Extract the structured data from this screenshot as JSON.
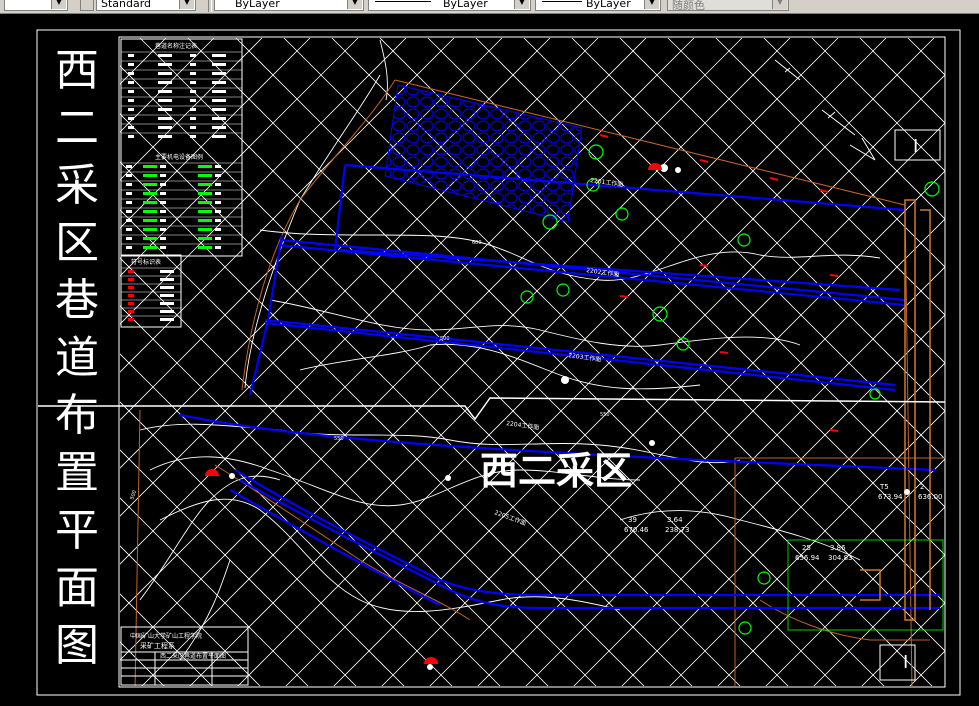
{
  "toolbar": {
    "text_style": "Standard",
    "layer": "ByLayer",
    "linetype": "ByLayer",
    "lineweight": "ByLayer",
    "plot_style": "随颜色"
  },
  "drawing": {
    "vertical_title": [
      "西",
      "二",
      "采",
      "区",
      "巷",
      "道",
      "布",
      "置",
      "平",
      "面",
      "图"
    ],
    "area_label": "西二采区",
    "section_marks": [
      "I",
      "I"
    ],
    "work_faces": [
      "2201工作面",
      "2202工作面",
      "2203工作面",
      "2204工作面",
      "2205工作面"
    ],
    "contour_labels": [
      "600",
      "500",
      "550",
      "550",
      "500"
    ],
    "point_labels": [
      {
        "name": "T5",
        "value": "673.94"
      },
      {
        "name": "2",
        "value": "3.55"
      },
      {
        "name": "2",
        "value": "636.00"
      },
      {
        "name": "39",
        "value": "670.46"
      },
      {
        "name": "3.64",
        "value": "238.73"
      },
      {
        "name": "25",
        "value": "656.94"
      },
      {
        "name": "3.86",
        "value": "304.83"
      }
    ],
    "legend_tables": [
      {
        "title": "巷道名称注记表"
      },
      {
        "title": "主要机电设备图例"
      },
      {
        "title": "符号标识表"
      }
    ],
    "title_block": {
      "school": "中国矿山大学矿山工程学院",
      "dept": "采矿工程系",
      "drawing_name": "西二采区巷道布置平面图"
    }
  },
  "colors": {
    "background": "#000000",
    "grid": "#ffffff",
    "roadway": "#0000ff",
    "boundary": "#c0642a",
    "contour": "#ffffff",
    "equipment": "#00ff00",
    "marker": "#ff0000"
  }
}
